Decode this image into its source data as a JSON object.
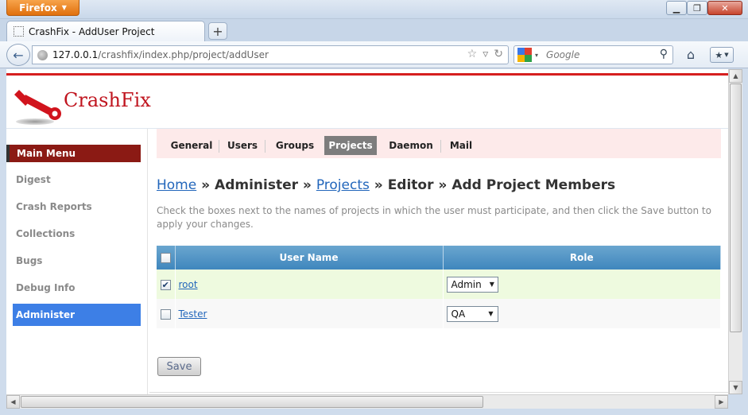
{
  "browser": {
    "menu_button": "Firefox",
    "tab_title": "CrashFix - AddUser Project",
    "url_host": "127.0.0.1",
    "url_path": "/crashfix/index.php/project/addUser",
    "search_placeholder": "Google"
  },
  "site": {
    "logo_text": "CrashFix",
    "brand_color": "#c0151f"
  },
  "sidebar": {
    "header": "Main Menu",
    "items": [
      {
        "label": "Digest",
        "active": false
      },
      {
        "label": "Crash Reports",
        "active": false
      },
      {
        "label": "Collections",
        "active": false
      },
      {
        "label": "Bugs",
        "active": false
      },
      {
        "label": "Debug Info",
        "active": false
      },
      {
        "label": "Administer",
        "active": true
      }
    ]
  },
  "topnav": {
    "items": [
      {
        "label": "General",
        "active": false
      },
      {
        "label": "Users",
        "active": false
      },
      {
        "label": "Groups",
        "active": false
      },
      {
        "label": "Projects",
        "active": true
      },
      {
        "label": "Daemon",
        "active": false
      },
      {
        "label": "Mail",
        "active": false
      }
    ]
  },
  "breadcrumb": {
    "home": "Home",
    "sep1": " » ",
    "administer": "Administer",
    "sep2": " » ",
    "projects": "Projects",
    "sep3": " » ",
    "editor": "Editor",
    "sep4": " » ",
    "current": "Add Project Members"
  },
  "instructions": "Check the boxes next to the names of projects in which the user must participate, and then click the Save button to apply your changes.",
  "table": {
    "headers": {
      "user_name": "User Name",
      "role": "Role"
    },
    "rows": [
      {
        "checked": true,
        "name": "root",
        "role": "Admin"
      },
      {
        "checked": false,
        "name": "Tester",
        "role": "QA"
      }
    ]
  },
  "save_label": "Save",
  "icons": {
    "back": "back-arrow-icon",
    "globe": "globe-icon",
    "star": "star-icon",
    "reload": "reload-icon",
    "search": "magnifier-icon",
    "home": "home-icon",
    "bookmark": "bookmark-icon"
  }
}
